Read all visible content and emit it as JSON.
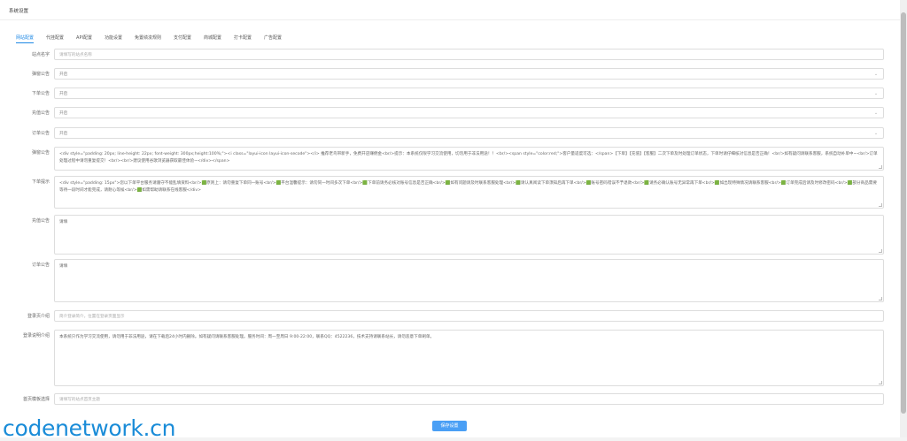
{
  "page_title": "系统设置",
  "tabs": [
    "网站配置",
    "代挂配置",
    "API配置",
    "功能设置",
    "免置绩浚规则",
    "支付配置",
    "商城配置",
    "打卡配置",
    "广告配置"
  ],
  "active_tab": 0,
  "rows": [
    {
      "label": "站点名字",
      "type": "input",
      "value": "",
      "placeholder": "请填写的站点名称"
    },
    {
      "label": "弹窗公告",
      "type": "select",
      "value": "开启"
    },
    {
      "label": "下单公告",
      "type": "select",
      "value": "开启"
    },
    {
      "label": "充值公告",
      "type": "select",
      "value": "开启"
    },
    {
      "label": "订单公告",
      "type": "select",
      "value": "开启"
    },
    {
      "label": "弹窗公告",
      "type": "textarea",
      "value": "<div style=\"padding: 20px; line-height: 22px; font-weight: 300px;height:100%;\"><i class=\"layui-icon layui-icon-secode\"></i> 推荐老鸟带新手，免费开店赚佣金<br/>提示：本系统仅限学习交流使用，切勿用于非法用途！！<br/><span style=\"color:red;\">客户量适度可选：</span>【下单】【充值】【客服】二次下单及时处理订单状态，下单时请仔细核对信息是否正确！<br/>如有疑问请联系客服，系统自动补单中~<br/>订单处理过程中请勿重复提交！<br/><br/>建议使用谷歌浏览器获取最佳体验~</div></span>"
    },
    {
      "label": "下单提示",
      "type": "textarea",
      "value": "<div style=\"padding: 15px\">您以下单平台服务请遵守不能乱填资料<br/>🟩原则上：请勿重复下单同一账号<br/>🟩平台温馨提示：请勿同一时间多次下单<br/>🟩下单前请务必核对账号信息是否正确<br/>🟩如有问题请及时联系客服处理<br/>🟩请认真阅读下单须知后再下单<br/>🟩账号密码错误不予退款<br/>🟩请务必确认账号无异常再下单<br/>🟩如出现特殊情况请联系客服<br/>🟩订单完成后请及时修改密码<br/>🟩部分商品需要等待一段时间才能完成，请耐心等候<br/>🟩如需帮助请联系在线客服</div>"
    },
    {
      "label": "充值公告",
      "type": "textarea",
      "value": "请填"
    },
    {
      "label": "订单公告",
      "type": "textarea",
      "value": "请填"
    },
    {
      "label": "登录页介绍",
      "type": "input",
      "value": "",
      "placeholder": "简介登录简介，位置在登录页面显示"
    },
    {
      "label": "登录说明介绍",
      "type": "textarea",
      "value": "本系统只作为学习交流使用，请勿用于非法用途，请在下载后24小时内删除。如有疑问请联系客服处理。服务时间：周一至周日 9:00-22:00，联系QQ：4522236，技术支持请联系站长，请勿恶意下单刷单。"
    },
    {
      "label": "首页模板选择",
      "type": "input",
      "value": "",
      "placeholder": "请填写的站点首页主题"
    }
  ],
  "save_label": "保存设置",
  "watermark": "codenetwork.cn"
}
